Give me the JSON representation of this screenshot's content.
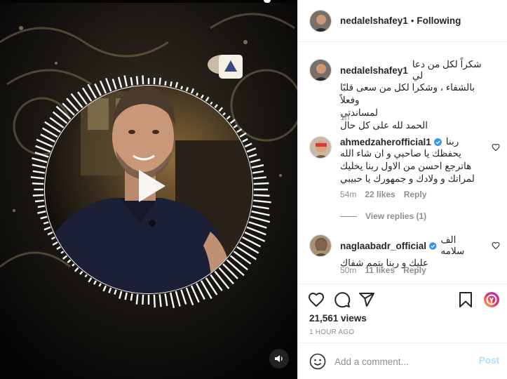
{
  "post": {
    "username": "nedalelshafey1",
    "follow_status": "Following",
    "separator": "•",
    "caption_lines": [
      "شكراً لكل من دعا لي",
      "بالشفاء ، وشكرا لكل من سعى قلبًا وفعلاً",
      "لمساندتي",
      "الحمد لله على كل حال"
    ],
    "caption_time": "1h",
    "views": "21,561 views",
    "posted_ago": "1 HOUR AGO"
  },
  "comments": [
    {
      "username": "ahmedzaherofficial1",
      "verified": true,
      "inline_text": "ربنا",
      "lines": [
        "يحفظك يا صاحبي و ان شاء الله",
        "هاترجع احسن من الاول ربنا يخليك",
        "لمراتك و ولادك و جمهورك يا حبيبي"
      ],
      "time": "54m",
      "likes": "22 likes",
      "reply": "Reply",
      "view_replies": "View replies (1)"
    },
    {
      "username": "naglaabadr_official",
      "verified": true,
      "inline_text": "الف سلامه",
      "lines": [
        "عليك و ربنا يتمم شفاك"
      ],
      "time": "50m",
      "likes": "11 likes",
      "reply": "Reply"
    }
  ],
  "add_comment": {
    "placeholder": "Add a comment...",
    "post_label": "Post"
  },
  "icons": {
    "like": "heart-icon",
    "comment": "comment-icon",
    "share": "paper-plane-icon",
    "save": "bookmark-icon",
    "emoji": "smiley-icon",
    "play": "play-icon",
    "volume": "speaker-icon",
    "brand_sticker": "brand-badge-icon"
  },
  "colors": {
    "accent_disabled": "#b2dffc",
    "verified": "#3897f0",
    "text": "#262626",
    "muted": "#8e8e8e"
  }
}
